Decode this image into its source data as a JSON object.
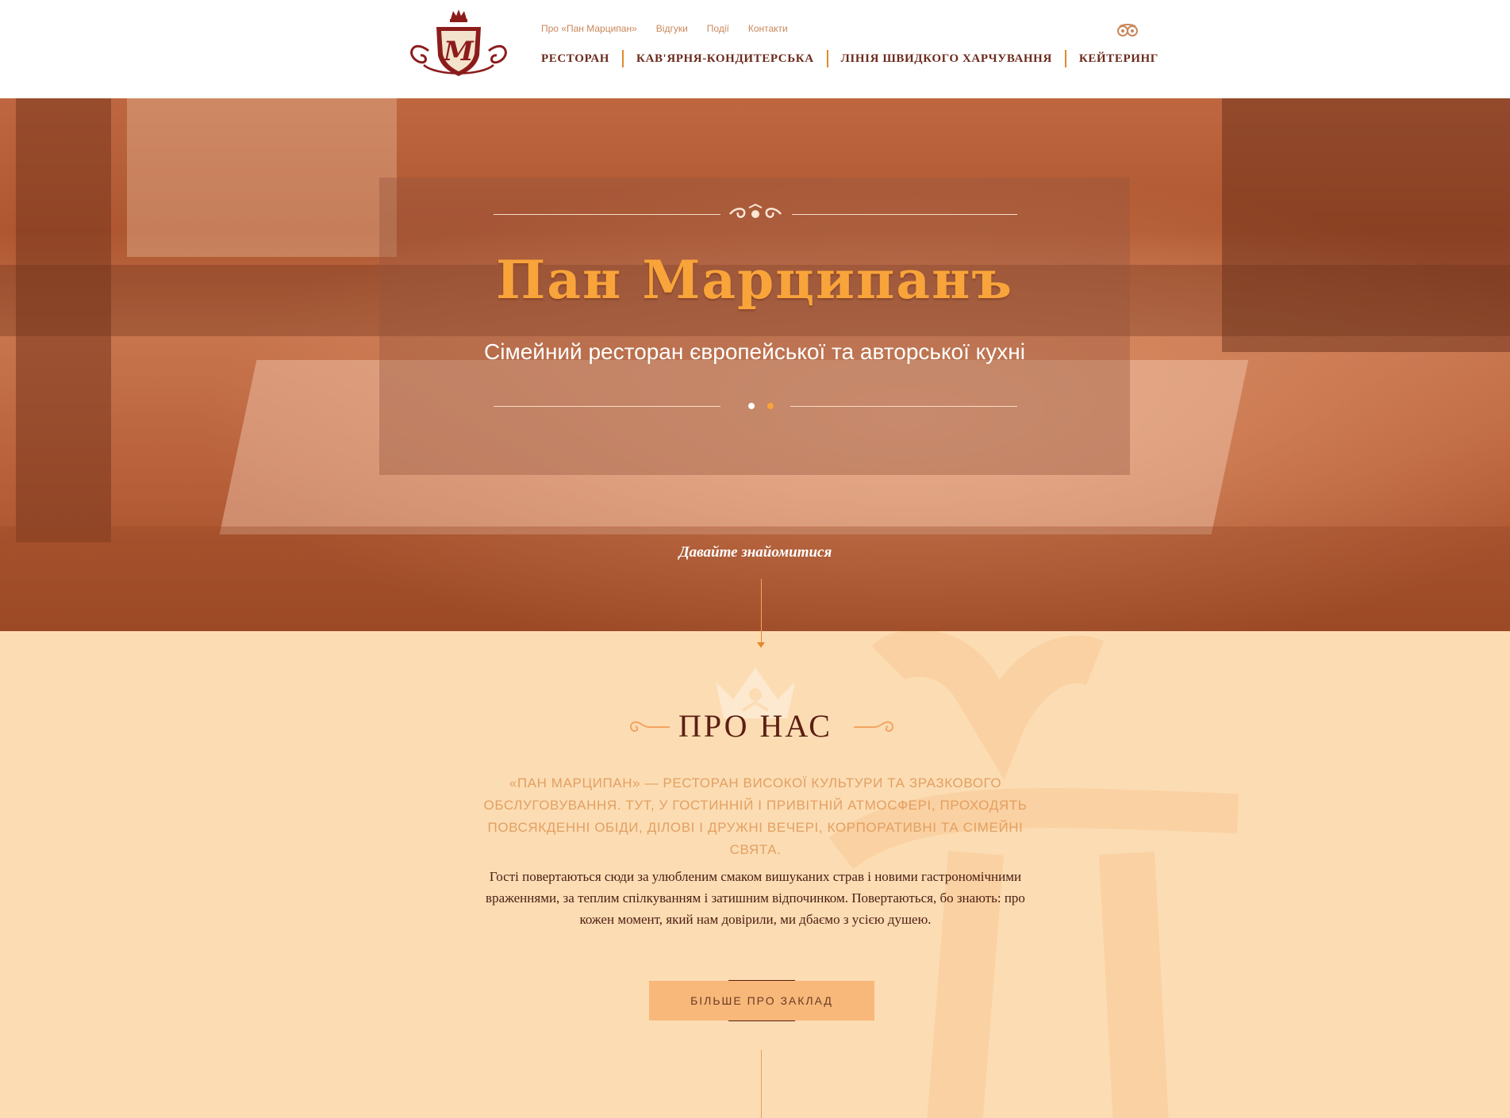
{
  "header": {
    "top_links": [
      "Про «Пан Марципан»",
      "Відгуки",
      "Події",
      "Контакти"
    ],
    "nav": [
      "РЕСТОРАН",
      "КАВ'ЯРНЯ-КОНДИТЕРСЬКА",
      "ЛІНІЯ ШВИДКОГО ХАРЧУВАННЯ",
      "КЕЙТЕРИНГ"
    ],
    "logo_letter": "M",
    "tripadvisor_icon": "owl-eyes-icon"
  },
  "hero": {
    "title": "Пан Марципанъ",
    "subtitle": "Сімейний ресторан європейської та авторської кухні",
    "intro_link": "Давайте знайомитися",
    "slides_count": 2,
    "active_slide": 1
  },
  "about": {
    "title": "ПРО НАС",
    "lead": "«ПАН МАРЦИПАН» — РЕСТОРАН ВИСОКОЇ КУЛЬТУРИ ТА ЗРАЗКОВОГО ОБСЛУГОВУВАННЯ. ТУТ, У ГОСТИННІЙ І ПРИВІТНІЙ АТМОСФЕРІ, ПРОХОДЯТЬ ПОВСЯКДЕННІ ОБІДИ, ДІЛОВІ І ДРУЖНІ ВЕЧЕРІ, КОРПОРАТИВНІ ТА СІМЕЙНІ СВЯТА.",
    "body": "Гості повертаються сюди за улюбленим смаком вишуканих страв і новими гастрономічними враженнями, за теплим спілкуванням і затишним відпочинком. Повертаються, бо знають: про кожен момент, який нам довірили, ми дбаємо з усією душею.",
    "button": "БІЛЬШЕ ПРО ЗАКЛАД"
  },
  "colors": {
    "accent": "#f8a43a",
    "brand_dark": "#6b2a1c",
    "about_bg": "#fcdcb3",
    "button_bg": "#f8b87a"
  }
}
